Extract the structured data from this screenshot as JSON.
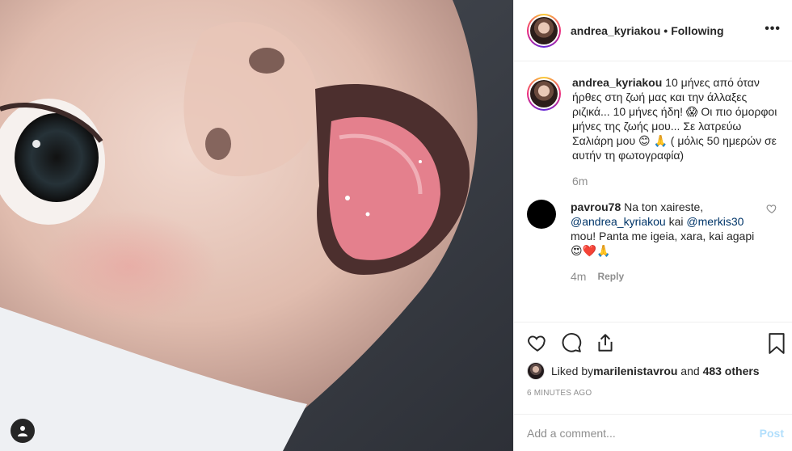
{
  "post": {
    "username": "andrea_kyriakou",
    "separator": "•",
    "follow_status": "Following",
    "more_label": "•••"
  },
  "caption": {
    "username": "andrea_kyriakou",
    "text": " 10 μήνες από όταν ήρθες στη ζωή μας και την άλλαξες ριζικά... 10 μήνες ήδη! 😱 Οι πιο όμορφοι μήνες της ζωής μου... Σε λατρεύω Σαλιάρη μου 😊 🙏 ( μόλις 50 ημερών σε αυτήν τη φωτογραφία)",
    "age": "6m"
  },
  "comment": {
    "username": "pavrou78",
    "text_before": " Na ton xaireste,",
    "mention1": "@andrea_kyriakou",
    "middle": " kai ",
    "mention2": "@merkis30",
    "text_after": " mou! Panta me igeia, xara, kai agapi 😍❤️🙏",
    "age": "4m",
    "reply_label": "Reply"
  },
  "likes": {
    "prefix": "Liked by ",
    "user": "marilenistavrou",
    "middle": " and ",
    "others": "483 others"
  },
  "timestamp": "6 MINUTES AGO",
  "add_comment": {
    "placeholder": "Add a comment...",
    "post_label": "Post"
  }
}
